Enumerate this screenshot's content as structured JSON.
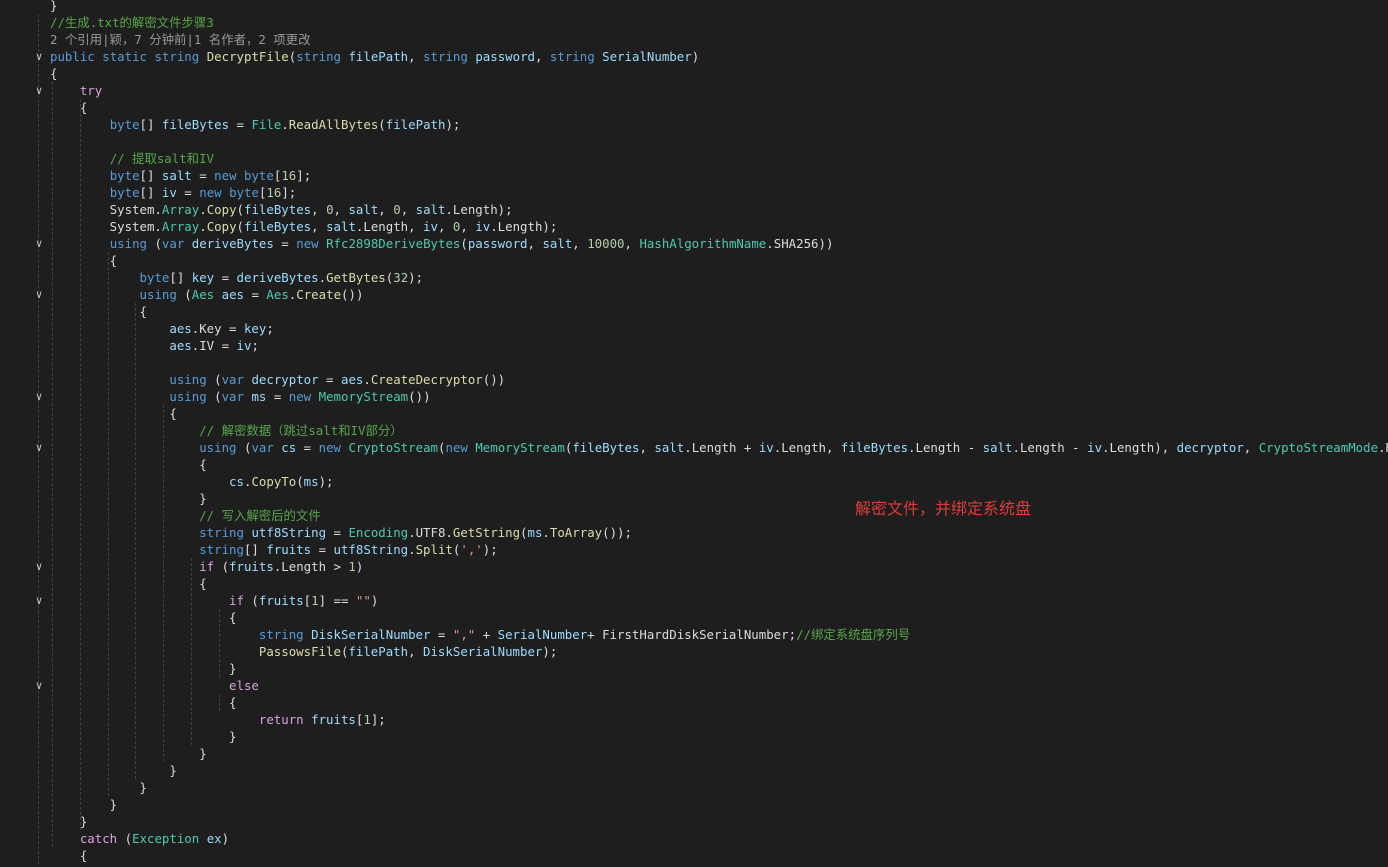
{
  "annotation": "解密文件，并绑定系统盘",
  "lines": [
    {
      "tokens": [
        [
          "pl",
          "}"
        ]
      ]
    },
    {
      "tokens": [
        [
          "cmt",
          "//生成.txt的解密文件步骤3"
        ]
      ]
    },
    {
      "lens": true,
      "tokens": [
        [
          "lens",
          "2 个引用|颖，7 分钟前|1 名作者，2 项更改"
        ]
      ]
    },
    {
      "fold": true,
      "tokens": [
        [
          "kw",
          "public"
        ],
        [
          "pl",
          " "
        ],
        [
          "kw",
          "static"
        ],
        [
          "pl",
          " "
        ],
        [
          "kw",
          "string"
        ],
        [
          "pl",
          " "
        ],
        [
          "fn",
          "DecryptFile"
        ],
        [
          "pl",
          "("
        ],
        [
          "kw",
          "string"
        ],
        [
          "pl",
          " "
        ],
        [
          "var",
          "filePath"
        ],
        [
          "pl",
          ", "
        ],
        [
          "kw",
          "string"
        ],
        [
          "pl",
          " "
        ],
        [
          "var",
          "password"
        ],
        [
          "pl",
          ", "
        ],
        [
          "kw",
          "string"
        ],
        [
          "pl",
          " "
        ],
        [
          "var",
          "SerialNumber"
        ],
        [
          "pl",
          ")"
        ]
      ]
    },
    {
      "tokens": [
        [
          "pl",
          "{"
        ]
      ]
    },
    {
      "fold": true,
      "tokens": [
        [
          "pl",
          "    "
        ],
        [
          "ctl",
          "try"
        ]
      ]
    },
    {
      "tokens": [
        [
          "pl",
          "    {"
        ]
      ]
    },
    {
      "tokens": [
        [
          "pl",
          "        "
        ],
        [
          "kw",
          "byte"
        ],
        [
          "pl",
          "[] "
        ],
        [
          "var",
          "fileBytes"
        ],
        [
          "pl",
          " = "
        ],
        [
          "type",
          "File"
        ],
        [
          "pl",
          "."
        ],
        [
          "fn",
          "ReadAllBytes"
        ],
        [
          "pl",
          "("
        ],
        [
          "var",
          "filePath"
        ],
        [
          "pl",
          ");"
        ]
      ]
    },
    {
      "tokens": []
    },
    {
      "tokens": [
        [
          "pl",
          "        "
        ],
        [
          "cmt",
          "// 提取salt和IV"
        ]
      ]
    },
    {
      "tokens": [
        [
          "pl",
          "        "
        ],
        [
          "kw",
          "byte"
        ],
        [
          "pl",
          "[] "
        ],
        [
          "var",
          "salt"
        ],
        [
          "pl",
          " = "
        ],
        [
          "kw",
          "new"
        ],
        [
          "pl",
          " "
        ],
        [
          "kw",
          "byte"
        ],
        [
          "pl",
          "["
        ],
        [
          "num",
          "16"
        ],
        [
          "pl",
          "];"
        ]
      ]
    },
    {
      "tokens": [
        [
          "pl",
          "        "
        ],
        [
          "kw",
          "byte"
        ],
        [
          "pl",
          "[] "
        ],
        [
          "var",
          "iv"
        ],
        [
          "pl",
          " = "
        ],
        [
          "kw",
          "new"
        ],
        [
          "pl",
          " "
        ],
        [
          "kw",
          "byte"
        ],
        [
          "pl",
          "["
        ],
        [
          "num",
          "16"
        ],
        [
          "pl",
          "];"
        ]
      ]
    },
    {
      "tokens": [
        [
          "pl",
          "        System."
        ],
        [
          "type",
          "Array"
        ],
        [
          "pl",
          "."
        ],
        [
          "fn",
          "Copy"
        ],
        [
          "pl",
          "("
        ],
        [
          "var",
          "fileBytes"
        ],
        [
          "pl",
          ", "
        ],
        [
          "num",
          "0"
        ],
        [
          "pl",
          ", "
        ],
        [
          "var",
          "salt"
        ],
        [
          "pl",
          ", "
        ],
        [
          "num",
          "0"
        ],
        [
          "pl",
          ", "
        ],
        [
          "var",
          "salt"
        ],
        [
          "pl",
          "."
        ],
        [
          "pl",
          "Length);"
        ]
      ]
    },
    {
      "tokens": [
        [
          "pl",
          "        System."
        ],
        [
          "type",
          "Array"
        ],
        [
          "pl",
          "."
        ],
        [
          "fn",
          "Copy"
        ],
        [
          "pl",
          "("
        ],
        [
          "var",
          "fileBytes"
        ],
        [
          "pl",
          ", "
        ],
        [
          "var",
          "salt"
        ],
        [
          "pl",
          ".Length, "
        ],
        [
          "var",
          "iv"
        ],
        [
          "pl",
          ", "
        ],
        [
          "num",
          "0"
        ],
        [
          "pl",
          ", "
        ],
        [
          "var",
          "iv"
        ],
        [
          "pl",
          ".Length);"
        ]
      ]
    },
    {
      "fold": true,
      "tokens": [
        [
          "pl",
          "        "
        ],
        [
          "kw",
          "using"
        ],
        [
          "pl",
          " ("
        ],
        [
          "kw",
          "var"
        ],
        [
          "pl",
          " "
        ],
        [
          "var",
          "deriveBytes"
        ],
        [
          "pl",
          " = "
        ],
        [
          "kw",
          "new"
        ],
        [
          "pl",
          " "
        ],
        [
          "type",
          "Rfc2898DeriveBytes"
        ],
        [
          "pl",
          "("
        ],
        [
          "var",
          "password"
        ],
        [
          "pl",
          ", "
        ],
        [
          "var",
          "salt"
        ],
        [
          "pl",
          ", "
        ],
        [
          "num",
          "10000"
        ],
        [
          "pl",
          ", "
        ],
        [
          "type",
          "HashAlgorithmName"
        ],
        [
          "pl",
          ".SHA256))"
        ]
      ]
    },
    {
      "tokens": [
        [
          "pl",
          "        {"
        ]
      ]
    },
    {
      "tokens": [
        [
          "pl",
          "            "
        ],
        [
          "kw",
          "byte"
        ],
        [
          "pl",
          "[] "
        ],
        [
          "var",
          "key"
        ],
        [
          "pl",
          " = "
        ],
        [
          "var",
          "deriveBytes"
        ],
        [
          "pl",
          "."
        ],
        [
          "fn",
          "GetBytes"
        ],
        [
          "pl",
          "("
        ],
        [
          "num",
          "32"
        ],
        [
          "pl",
          ");"
        ]
      ]
    },
    {
      "fold": true,
      "tokens": [
        [
          "pl",
          "            "
        ],
        [
          "kw",
          "using"
        ],
        [
          "pl",
          " ("
        ],
        [
          "type",
          "Aes"
        ],
        [
          "pl",
          " "
        ],
        [
          "var",
          "aes"
        ],
        [
          "pl",
          " = "
        ],
        [
          "type",
          "Aes"
        ],
        [
          "pl",
          "."
        ],
        [
          "fn",
          "Create"
        ],
        [
          "pl",
          "())"
        ]
      ]
    },
    {
      "tokens": [
        [
          "pl",
          "            {"
        ]
      ]
    },
    {
      "tokens": [
        [
          "pl",
          "                "
        ],
        [
          "var",
          "aes"
        ],
        [
          "pl",
          ".Key = "
        ],
        [
          "var",
          "key"
        ],
        [
          "pl",
          ";"
        ]
      ]
    },
    {
      "tokens": [
        [
          "pl",
          "                "
        ],
        [
          "var",
          "aes"
        ],
        [
          "pl",
          ".IV = "
        ],
        [
          "var",
          "iv"
        ],
        [
          "pl",
          ";"
        ]
      ]
    },
    {
      "tokens": []
    },
    {
      "tokens": [
        [
          "pl",
          "                "
        ],
        [
          "kw",
          "using"
        ],
        [
          "pl",
          " ("
        ],
        [
          "kw",
          "var"
        ],
        [
          "pl",
          " "
        ],
        [
          "var",
          "decryptor"
        ],
        [
          "pl",
          " = "
        ],
        [
          "var",
          "aes"
        ],
        [
          "pl",
          "."
        ],
        [
          "fn",
          "CreateDecryptor"
        ],
        [
          "pl",
          "())"
        ]
      ]
    },
    {
      "fold": true,
      "tokens": [
        [
          "pl",
          "                "
        ],
        [
          "kw",
          "using"
        ],
        [
          "pl",
          " ("
        ],
        [
          "kw",
          "var"
        ],
        [
          "pl",
          " "
        ],
        [
          "var",
          "ms"
        ],
        [
          "pl",
          " = "
        ],
        [
          "kw",
          "new"
        ],
        [
          "pl",
          " "
        ],
        [
          "type",
          "MemoryStream"
        ],
        [
          "pl",
          "())"
        ]
      ]
    },
    {
      "tokens": [
        [
          "pl",
          "                {"
        ]
      ]
    },
    {
      "tokens": [
        [
          "pl",
          "                    "
        ],
        [
          "cmt",
          "// 解密数据（跳过salt和IV部分）"
        ]
      ]
    },
    {
      "fold": true,
      "tokens": [
        [
          "pl",
          "                    "
        ],
        [
          "kw",
          "using"
        ],
        [
          "pl",
          " ("
        ],
        [
          "kw",
          "var"
        ],
        [
          "pl",
          " "
        ],
        [
          "var",
          "cs"
        ],
        [
          "pl",
          " = "
        ],
        [
          "kw",
          "new"
        ],
        [
          "pl",
          " "
        ],
        [
          "type",
          "CryptoStream"
        ],
        [
          "pl",
          "("
        ],
        [
          "kw",
          "new"
        ],
        [
          "pl",
          " "
        ],
        [
          "type",
          "MemoryStream"
        ],
        [
          "pl",
          "("
        ],
        [
          "var",
          "fileBytes"
        ],
        [
          "pl",
          ", "
        ],
        [
          "var",
          "salt"
        ],
        [
          "pl",
          ".Length + "
        ],
        [
          "var",
          "iv"
        ],
        [
          "pl",
          ".Length, "
        ],
        [
          "var",
          "fileBytes"
        ],
        [
          "pl",
          ".Length - "
        ],
        [
          "var",
          "salt"
        ],
        [
          "pl",
          ".Length - "
        ],
        [
          "var",
          "iv"
        ],
        [
          "pl",
          ".Length), "
        ],
        [
          "var",
          "decryptor"
        ],
        [
          "pl",
          ", "
        ],
        [
          "type",
          "CryptoStreamMode"
        ],
        [
          "pl",
          ".Read))"
        ]
      ]
    },
    {
      "tokens": [
        [
          "pl",
          "                    {"
        ]
      ]
    },
    {
      "tokens": [
        [
          "pl",
          "                        "
        ],
        [
          "var",
          "cs"
        ],
        [
          "pl",
          "."
        ],
        [
          "fn",
          "CopyTo"
        ],
        [
          "pl",
          "("
        ],
        [
          "var",
          "ms"
        ],
        [
          "pl",
          ");"
        ]
      ]
    },
    {
      "tokens": [
        [
          "pl",
          "                    }"
        ]
      ]
    },
    {
      "tokens": [
        [
          "pl",
          "                    "
        ],
        [
          "cmt",
          "// 写入解密后的文件"
        ]
      ]
    },
    {
      "tokens": [
        [
          "pl",
          "                    "
        ],
        [
          "kw",
          "string"
        ],
        [
          "pl",
          " "
        ],
        [
          "var",
          "utf8String"
        ],
        [
          "pl",
          " = "
        ],
        [
          "type",
          "Encoding"
        ],
        [
          "pl",
          ".UTF8."
        ],
        [
          "fn",
          "GetString"
        ],
        [
          "pl",
          "("
        ],
        [
          "var",
          "ms"
        ],
        [
          "pl",
          "."
        ],
        [
          "fn",
          "ToArray"
        ],
        [
          "pl",
          "());"
        ]
      ]
    },
    {
      "tokens": [
        [
          "pl",
          "                    "
        ],
        [
          "kw",
          "string"
        ],
        [
          "pl",
          "[] "
        ],
        [
          "var",
          "fruits"
        ],
        [
          "pl",
          " = "
        ],
        [
          "var",
          "utf8String"
        ],
        [
          "pl",
          "."
        ],
        [
          "fn",
          "Split"
        ],
        [
          "pl",
          "("
        ],
        [
          "str",
          "','"
        ],
        [
          "pl",
          ");"
        ]
      ]
    },
    {
      "fold": true,
      "tokens": [
        [
          "pl",
          "                    "
        ],
        [
          "ctl",
          "if"
        ],
        [
          "pl",
          " ("
        ],
        [
          "var",
          "fruits"
        ],
        [
          "pl",
          ".Length > "
        ],
        [
          "num",
          "1"
        ],
        [
          "pl",
          ")"
        ]
      ]
    },
    {
      "tokens": [
        [
          "pl",
          "                    {"
        ]
      ]
    },
    {
      "fold": true,
      "tokens": [
        [
          "pl",
          "                        "
        ],
        [
          "ctl",
          "if"
        ],
        [
          "pl",
          " ("
        ],
        [
          "var",
          "fruits"
        ],
        [
          "pl",
          "["
        ],
        [
          "num",
          "1"
        ],
        [
          "pl",
          "] == "
        ],
        [
          "str",
          "\"\""
        ],
        [
          "pl",
          ")"
        ]
      ]
    },
    {
      "tokens": [
        [
          "pl",
          "                        {"
        ]
      ]
    },
    {
      "tokens": [
        [
          "pl",
          "                            "
        ],
        [
          "kw",
          "string"
        ],
        [
          "pl",
          " "
        ],
        [
          "var",
          "DiskSerialNumber"
        ],
        [
          "pl",
          " = "
        ],
        [
          "str",
          "\",\""
        ],
        [
          "pl",
          " + "
        ],
        [
          "var",
          "SerialNumber"
        ],
        [
          "pl",
          "+ "
        ],
        [
          "pl",
          "FirstHardDiskSerialNumber;"
        ],
        [
          "cmt",
          "//绑定系统盘序列号"
        ]
      ]
    },
    {
      "tokens": [
        [
          "pl",
          "                            "
        ],
        [
          "fn",
          "PassowsFile"
        ],
        [
          "pl",
          "("
        ],
        [
          "var",
          "filePath"
        ],
        [
          "pl",
          ", "
        ],
        [
          "var",
          "DiskSerialNumber"
        ],
        [
          "pl",
          ");"
        ]
      ]
    },
    {
      "tokens": [
        [
          "pl",
          "                        }"
        ]
      ]
    },
    {
      "fold": true,
      "tokens": [
        [
          "pl",
          "                        "
        ],
        [
          "ctl",
          "else"
        ]
      ]
    },
    {
      "tokens": [
        [
          "pl",
          "                        {"
        ]
      ]
    },
    {
      "tokens": [
        [
          "pl",
          "                            "
        ],
        [
          "ctl",
          "return"
        ],
        [
          "pl",
          " "
        ],
        [
          "var",
          "fruits"
        ],
        [
          "pl",
          "["
        ],
        [
          "num",
          "1"
        ],
        [
          "pl",
          "];"
        ]
      ]
    },
    {
      "tokens": [
        [
          "pl",
          "                        }"
        ]
      ]
    },
    {
      "tokens": [
        [
          "pl",
          "                    }"
        ]
      ]
    },
    {
      "tokens": [
        [
          "pl",
          "                }"
        ]
      ]
    },
    {
      "tokens": [
        [
          "pl",
          "            }"
        ]
      ]
    },
    {
      "tokens": [
        [
          "pl",
          "        }"
        ]
      ]
    },
    {
      "tokens": [
        [
          "pl",
          "    }"
        ]
      ]
    },
    {
      "tokens": [
        [
          "pl",
          "    "
        ],
        [
          "ctl",
          "catch"
        ],
        [
          "pl",
          " ("
        ],
        [
          "type",
          "Exception"
        ],
        [
          "pl",
          " "
        ],
        [
          "var",
          "ex"
        ],
        [
          "pl",
          ")"
        ]
      ]
    },
    {
      "tokens": [
        [
          "pl",
          "    {"
        ]
      ]
    }
  ]
}
